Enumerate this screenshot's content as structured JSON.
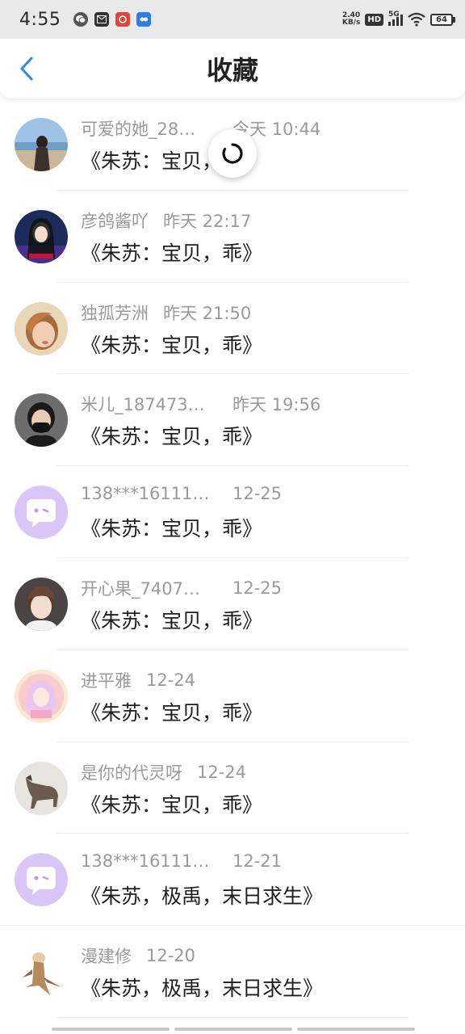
{
  "status_bar": {
    "time": "4:55",
    "net_speed_value": "2.40",
    "net_speed_unit": "KB/s",
    "hd_badge": "HD",
    "signal_label": "5G",
    "battery": "64"
  },
  "header": {
    "title": "收藏"
  },
  "favorites": [
    {
      "name": "可爱的她_28…",
      "time": "今天 10:44",
      "title": "《朱苏：宝贝，乖》"
    },
    {
      "name": "彦鸽酱吖",
      "time": "昨天 22:17",
      "title": "《朱苏：宝贝，乖》"
    },
    {
      "name": "独孤芳洲",
      "time": "昨天 21:50",
      "title": "《朱苏：宝贝，乖》"
    },
    {
      "name": "米儿_187473…",
      "time": "昨天 19:56",
      "title": "《朱苏：宝贝，乖》"
    },
    {
      "name": "138***16111…",
      "time": "12-25",
      "title": "《朱苏：宝贝，乖》"
    },
    {
      "name": "开心果_7407…",
      "time": "12-25",
      "title": "《朱苏：宝贝，乖》"
    },
    {
      "name": "进平雅",
      "time": "12-24",
      "title": "《朱苏：宝贝，乖》"
    },
    {
      "name": "是你的代灵呀",
      "time": "12-24",
      "title": "《朱苏：宝贝，乖》"
    },
    {
      "name": "138***16111…",
      "time": "12-21",
      "title": "《朱苏，极禹，末日求生》"
    },
    {
      "name": "漫建修",
      "time": "12-20",
      "title": "《朱苏，极禹，末日求生》"
    }
  ],
  "colors": {
    "accent": "#2f8bf0",
    "default_avatar_bg": "#d9c6f7"
  }
}
